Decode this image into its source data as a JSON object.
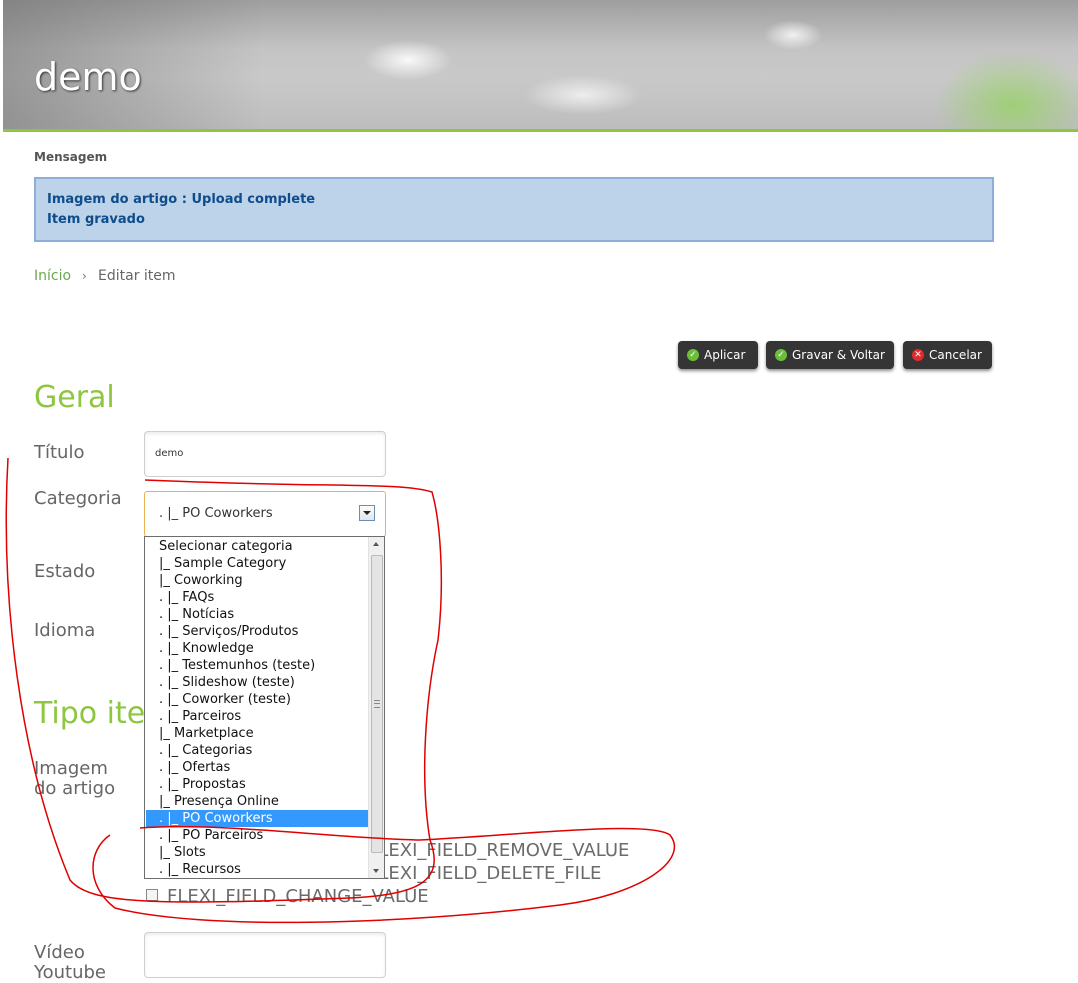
{
  "header": {
    "site_title": "demo"
  },
  "message": {
    "heading": "Mensagem",
    "lines": [
      "Imagem do artigo : Upload complete",
      "Item gravado"
    ]
  },
  "breadcrumb": {
    "home": "Início",
    "separator": "›",
    "current": "Editar item"
  },
  "toolbar": {
    "apply_label": "Aplicar",
    "save_back_label": "Gravar & Voltar",
    "cancel_label": "Cancelar",
    "ok_icon": "check-circle-icon",
    "cancel_icon": "x-circle-icon"
  },
  "form": {
    "section_general": "Geral",
    "title_label": "Título",
    "title_value": "demo",
    "category_label": "Categoria",
    "category_selected": ". |_ PO Coworkers",
    "state_label": "Estado",
    "language_label": "Idioma",
    "section_type": "Tipo ite",
    "image_label_line1": "Imagem",
    "image_label_line2": "do artigo",
    "remove_value": "FLEXI_FIELD_REMOVE_VALUE",
    "delete_file": "FLEXI_FIELD_DELETE_FILE",
    "change_value": "FLEXI_FIELD_CHANGE_VALUE",
    "video_label_line1": "Vídeo",
    "video_label_line2": "Youtube"
  },
  "dropdown": {
    "options": [
      "Selecionar categoria",
      "|_ Sample Category",
      "|_ Coworking",
      ". |_ FAQs",
      ". |_ Notícias",
      ". |_ Serviços/Produtos",
      ". |_ Knowledge",
      ". |_ Testemunhos (teste)",
      ". |_ Slideshow (teste)",
      ". |_ Coworker (teste)",
      ". |_ Parceiros",
      "|_ Marketplace",
      ". |_ Categorias",
      ". |_ Ofertas",
      ". |_ Propostas",
      "|_ Presença Online",
      ". |_ PO Coworkers",
      ". |_ PO Parceiros",
      "|_ Slots",
      ". |_ Recursos"
    ],
    "selected_index": 16
  },
  "colors": {
    "accent_green": "#8dc63f",
    "message_bg": "#bdd3e9",
    "message_text": "#0f4c8c",
    "annotation_red": "#e00000",
    "selection_blue": "#3399ff"
  }
}
